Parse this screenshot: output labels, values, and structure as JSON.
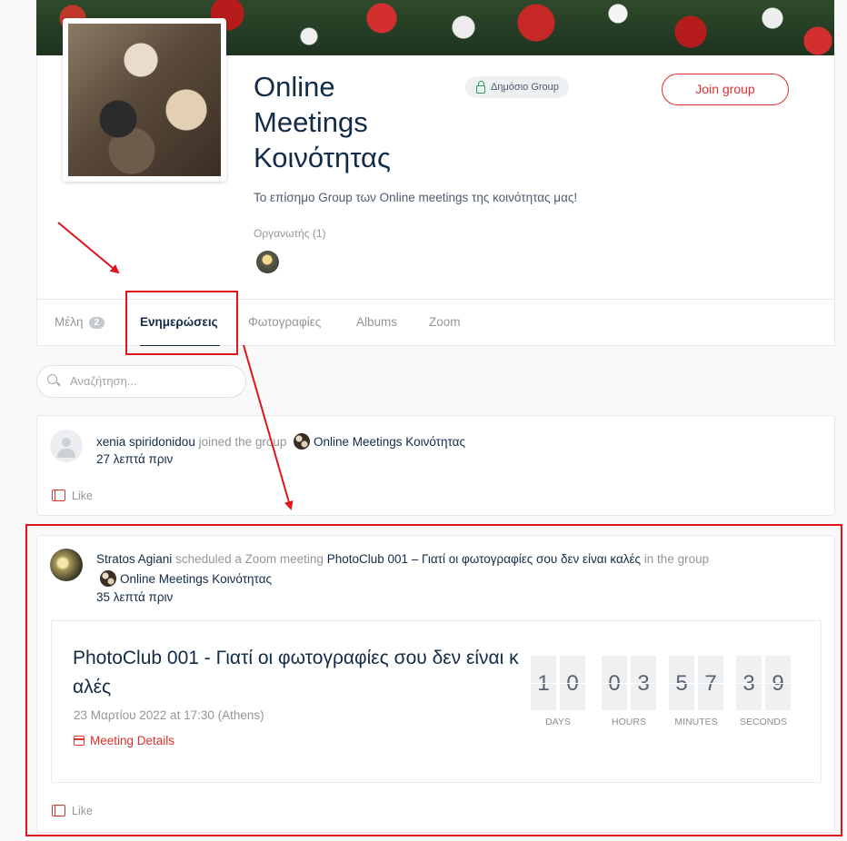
{
  "group": {
    "title": "Online Meetings Κοινότητας",
    "badge": "Δημόσιο Group",
    "join_label": "Join group",
    "description": "Το επίσημο Group των Online meetings της κοινότητας μας!",
    "organizers": "Οργανωτής (1)"
  },
  "tabs": [
    {
      "label": "Μέλη",
      "count": "2"
    },
    {
      "label": "Ενημερώσεις"
    },
    {
      "label": "Φωτογραφίες"
    },
    {
      "label": "Albums"
    },
    {
      "label": "Zoom"
    }
  ],
  "search": {
    "placeholder": "Αναζήτηση..."
  },
  "activity1": {
    "user": "xenia spiridonidou",
    "action": "joined the group",
    "group": "Online Meetings Κοινότητας",
    "time": "27 λεπτά πριν",
    "like": "Like"
  },
  "activity2": {
    "user": "Stratos Agiani",
    "action": "scheduled a Zoom meeting",
    "meeting": "PhotoClub 001 – Γιατί οι φωτογραφίες σου δεν είναι καλές",
    "in_group": "in the group",
    "group": "Online Meetings Κοινότητας",
    "time": "35 λεπτά πριν",
    "like": "Like"
  },
  "meeting_card": {
    "title_line1": "PhotoClub 001 - Γιατί οι φωτογραφίες σου δεν είναι κ",
    "title_line2": "αλές",
    "date": "23 Μαρτίου 2022 at 17:30 (Athens)",
    "details_label": "Meeting Details"
  },
  "countdown": {
    "days": [
      "1",
      "0"
    ],
    "hours": [
      "0",
      "3"
    ],
    "minutes": [
      "5",
      "7"
    ],
    "seconds": [
      "3",
      "9"
    ],
    "labels": {
      "days": "DAYS",
      "hours": "HOURS",
      "minutes": "MINUTES",
      "seconds": "SECONDS"
    }
  },
  "colors": {
    "accent": "#e0302c",
    "annotation": "#e0141c",
    "text": "#122b46"
  }
}
